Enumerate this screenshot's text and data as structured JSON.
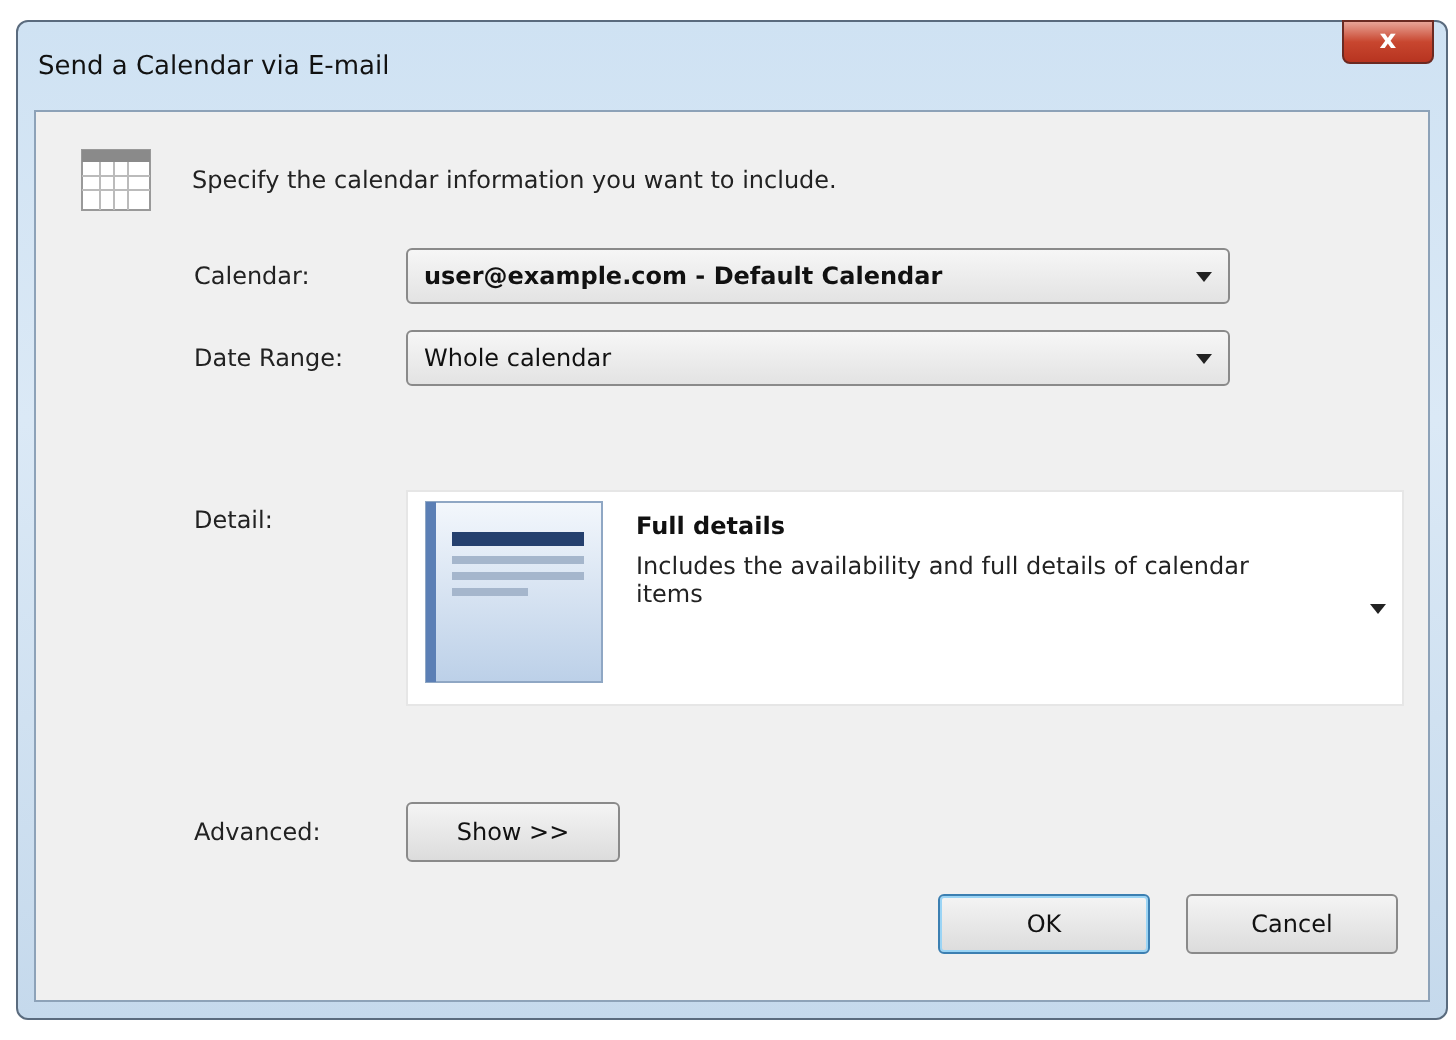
{
  "window": {
    "title": "Send a Calendar via E-mail",
    "close": "x"
  },
  "intro": "Specify the calendar information you want to include.",
  "fields": [
    {
      "label": "Calendar:",
      "value": "user@example.com - Default Calendar",
      "bold": true
    },
    {
      "label": "Date Range:",
      "value": "Whole calendar",
      "bold": false
    }
  ],
  "detail": {
    "label": "Detail:",
    "title": "Full details",
    "description": "Includes the availability and full details of calendar items"
  },
  "advanced": {
    "label": "Advanced:",
    "button": "Show >>"
  },
  "buttons": [
    {
      "label": "OK",
      "default": true
    },
    {
      "label": "Cancel",
      "default": false
    }
  ]
}
